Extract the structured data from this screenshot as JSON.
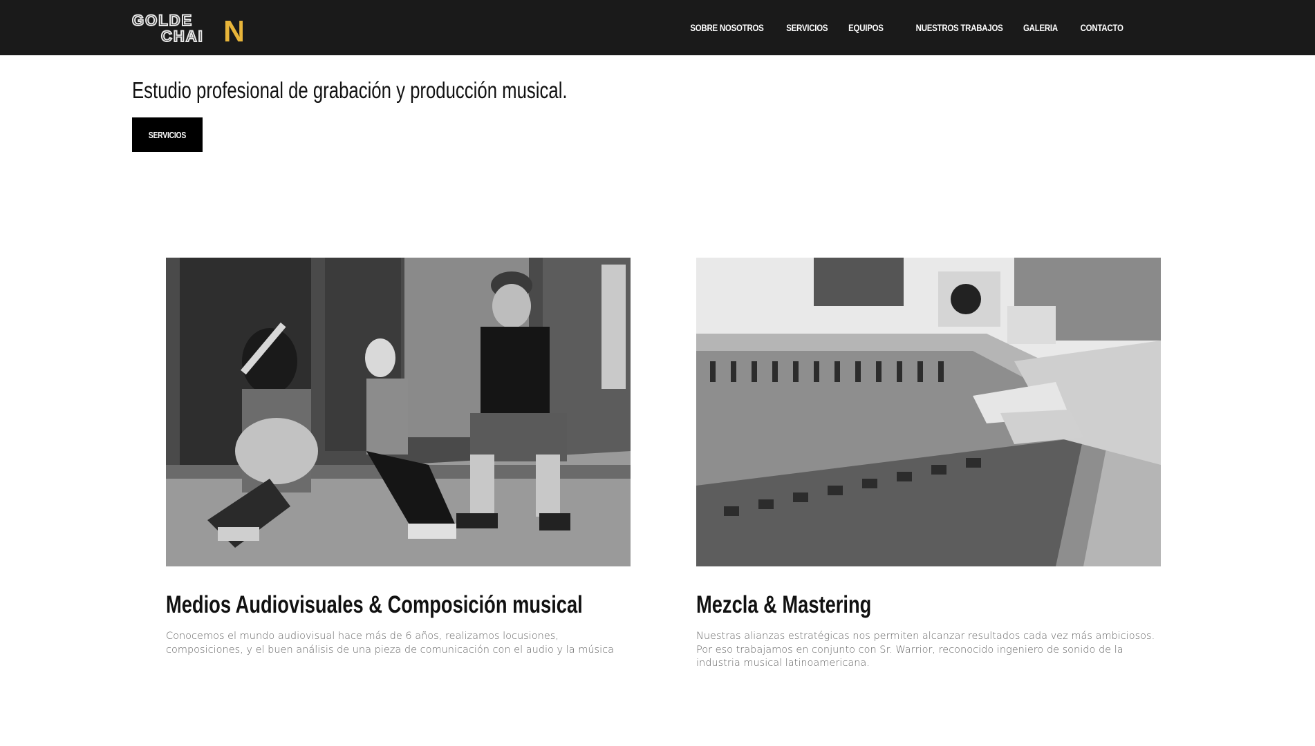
{
  "header": {
    "logo": {
      "line1": "GOLDE",
      "line2": "CHAI",
      "accent_letter": "N",
      "accent_color": "#e8b53a"
    },
    "nav": [
      {
        "label": "SOBRE NOSOTROS"
      },
      {
        "label": "SERVICIOS"
      },
      {
        "label": "EQUIPOS"
      },
      {
        "label": "NUESTROS TRABAJOS"
      },
      {
        "label": "GALERIA"
      },
      {
        "label": "CONTACTO"
      }
    ]
  },
  "hero": {
    "title": "Estudio profesional de grabación y producción musical.",
    "button_label": "SERVICIOS"
  },
  "cards": [
    {
      "title": "Medios Audiovisuales & Composición musical",
      "text": "Conocemos el mundo audiovisual hace más de 6 años, realizamos locusiones, composiciones, y el buen análisis de una pieza de comunicación con el audio y la música",
      "image": "street-musicians-photo"
    },
    {
      "title": "Mezcla & Mastering",
      "text": "Nuestras alianzas estratégicas nos permiten alcanzar resultados cada vez más ambiciosos. Por eso trabajamos en conjunto con Sr. Warrior, reconocido ingeniero de sonido de la industria musical latinoamericana.",
      "image": "mixing-console-photo"
    }
  ]
}
